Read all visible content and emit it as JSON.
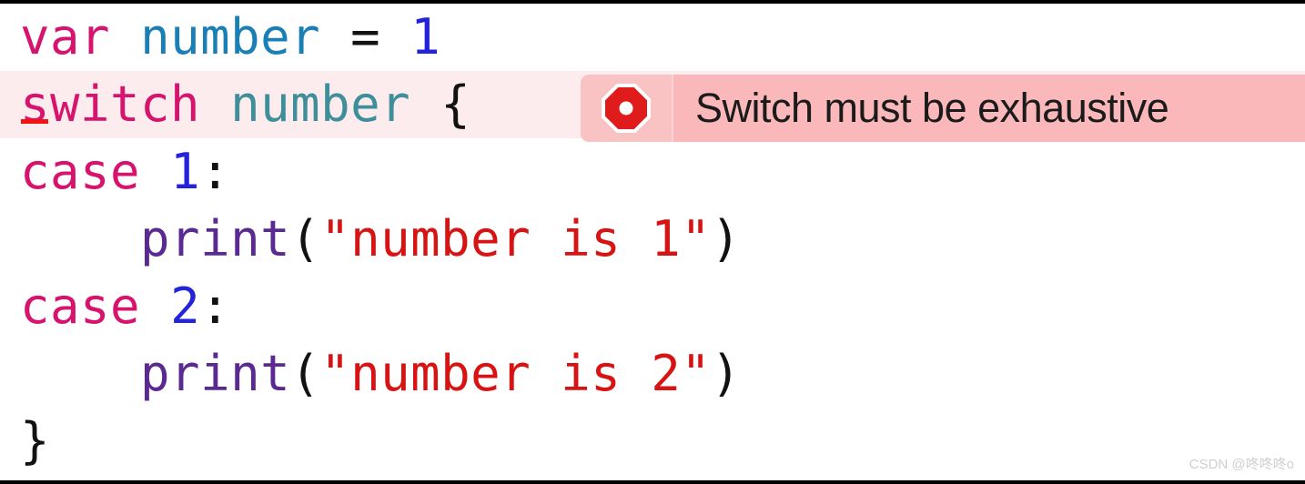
{
  "editor": {
    "lines": [
      {
        "id": "line-var-declaration",
        "tokens": [
          {
            "text": "var",
            "kind": "keyword"
          },
          {
            "text": " ",
            "kind": "plain"
          },
          {
            "text": "number",
            "kind": "ident"
          },
          {
            "text": " ",
            "kind": "plain"
          },
          {
            "text": "=",
            "kind": "punct"
          },
          {
            "text": " ",
            "kind": "plain"
          },
          {
            "text": "1",
            "kind": "number"
          }
        ]
      },
      {
        "id": "line-switch-statement",
        "tokens": [
          {
            "text": "s",
            "kind": "keyword-underlined"
          },
          {
            "text": "witch",
            "kind": "keyword"
          },
          {
            "text": " ",
            "kind": "plain"
          },
          {
            "text": "number",
            "kind": "ident-dim"
          },
          {
            "text": " ",
            "kind": "plain"
          },
          {
            "text": "{",
            "kind": "punct"
          }
        ]
      },
      {
        "id": "line-case-1",
        "tokens": [
          {
            "text": "case",
            "kind": "keyword"
          },
          {
            "text": " ",
            "kind": "plain"
          },
          {
            "text": "1",
            "kind": "number"
          },
          {
            "text": ":",
            "kind": "punct"
          }
        ]
      },
      {
        "id": "line-print-1",
        "tokens": [
          {
            "text": "    ",
            "kind": "plain"
          },
          {
            "text": "print",
            "kind": "func"
          },
          {
            "text": "(",
            "kind": "punct"
          },
          {
            "text": "\"number is 1\"",
            "kind": "string"
          },
          {
            "text": ")",
            "kind": "punct"
          }
        ]
      },
      {
        "id": "line-case-2",
        "tokens": [
          {
            "text": "case",
            "kind": "keyword"
          },
          {
            "text": " ",
            "kind": "plain"
          },
          {
            "text": "2",
            "kind": "number"
          },
          {
            "text": ":",
            "kind": "punct"
          }
        ]
      },
      {
        "id": "line-print-2",
        "tokens": [
          {
            "text": "    ",
            "kind": "plain"
          },
          {
            "text": "print",
            "kind": "func"
          },
          {
            "text": "(",
            "kind": "punct"
          },
          {
            "text": "\"number is 2\"",
            "kind": "string"
          },
          {
            "text": ")",
            "kind": "punct"
          }
        ]
      },
      {
        "id": "line-closing-brace",
        "tokens": [
          {
            "text": "}",
            "kind": "punct"
          }
        ]
      }
    ]
  },
  "error_banner": {
    "icon": "stop-octagon-error-icon",
    "message": "Switch must be exhaustive",
    "icon_fill": "#e01b1b",
    "icon_stroke": "#ffffff",
    "icon_well_background": "#f9c3c4",
    "panel_background": "#fbb8ba",
    "line_highlight_background": "#fdeced"
  },
  "watermark": {
    "text": "CSDN @咚咚咚o"
  },
  "colors": {
    "keyword": "#d6146e",
    "identifier": "#1a7fb5",
    "identifier_dim": "#3f8f9b",
    "number_literal": "#2323dc",
    "function": "#5a2a92",
    "string": "#d71313",
    "punctuation": "#121212",
    "error_underline": "#f01414"
  }
}
